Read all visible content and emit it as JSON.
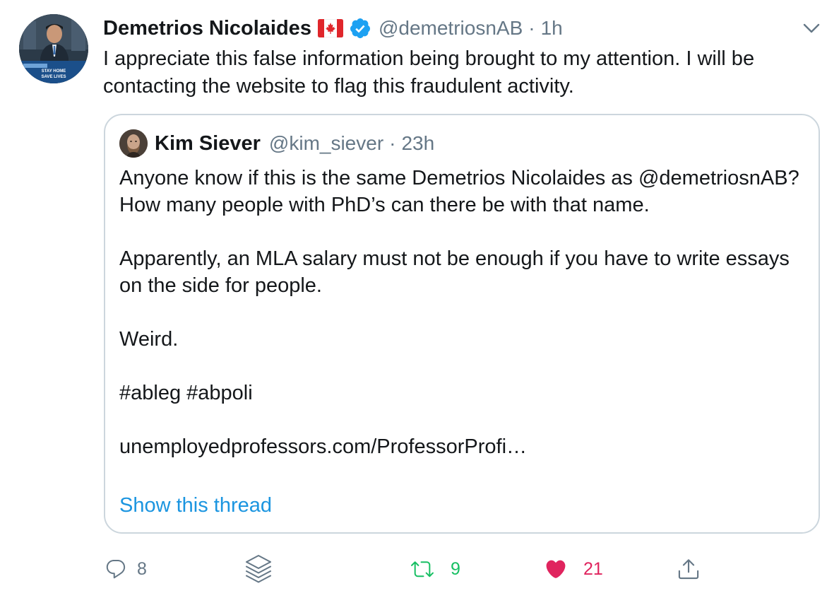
{
  "tweet": {
    "author": {
      "display_name": "Demetrios Nicolaides",
      "handle": "@demetriosnAB",
      "flag_icon": "canada-flag-icon",
      "verified_icon": "verified-badge-icon",
      "avatar_caption": [
        "STAY HOME",
        "SAVE LIVES"
      ]
    },
    "separator": "·",
    "time": "1h",
    "text": "I appreciate this false information being brought to my attention. I will be contacting the website to flag this fraudulent activity.",
    "quoted": {
      "author": {
        "display_name": "Kim Siever",
        "handle": "@kim_siever"
      },
      "time": "23h",
      "paragraphs": [
        "Anyone know if this is the same Demetrios Nicolaides as @demetriosnAB? How many people with PhD’s can there be with that name.",
        "Apparently, an MLA salary must not be enough if you have to write essays on the side for people.",
        "Weird.",
        "#ableg #abpoli",
        "unemployedprofessors.com/ProfessorProfi…"
      ],
      "show_thread": "Show this thread"
    },
    "actions": {
      "reply": {
        "icon": "reply-icon",
        "count": "8"
      },
      "stack": {
        "icon": "stack-icon"
      },
      "retweet": {
        "icon": "retweet-icon",
        "count": "9"
      },
      "like": {
        "icon": "heart-icon",
        "count": "21"
      },
      "share": {
        "icon": "share-icon"
      }
    }
  },
  "colors": {
    "text": "#14171a",
    "secondary": "#657786",
    "link": "#1b95e0",
    "retweet": "#17bf63",
    "like": "#e0245e",
    "border": "#ccd6dd",
    "verified": "#1da1f2"
  }
}
